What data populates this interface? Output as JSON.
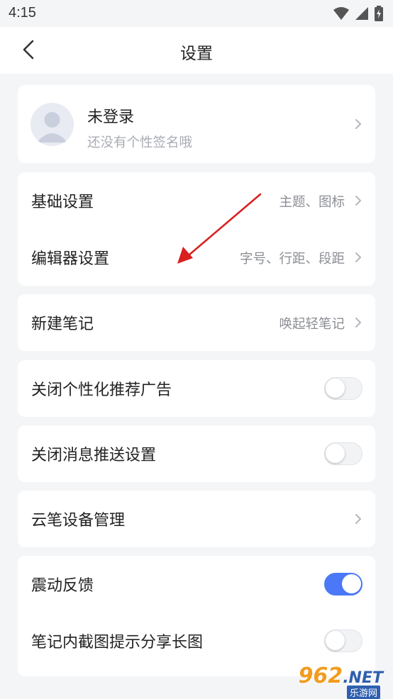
{
  "status_bar": {
    "time": "4:15",
    "icons": [
      "wifi-icon",
      "signal-icon",
      "battery-icon"
    ]
  },
  "header": {
    "title": "设置",
    "back_icon": "chevron-left-icon"
  },
  "user_card": {
    "name": "未登录",
    "signature": "还没有个性签名哦"
  },
  "settings": {
    "basic": {
      "label": "基础设置",
      "value": "主题、图标"
    },
    "editor": {
      "label": "编辑器设置",
      "value": "字号、行距、段距"
    },
    "new_note": {
      "label": "新建笔记",
      "value": "唤起轻笔记"
    },
    "close_ads": {
      "label": "关闭个性化推荐广告",
      "enabled": false
    },
    "close_push": {
      "label": "关闭消息推送设置",
      "enabled": false
    },
    "pen_device": {
      "label": "云笔设备管理"
    },
    "vibration": {
      "label": "震动反馈",
      "enabled": true
    },
    "screenshot_share": {
      "label": "笔记内截图提示分享长图",
      "enabled": false
    }
  },
  "annotation": {
    "arrow_color": "#d9201f"
  },
  "watermark": {
    "brand": "962",
    "suffix": ".NET",
    "sub": "乐游网"
  },
  "colors": {
    "accent": "#4a78f6",
    "background": "#f4f5f7",
    "secondary_text": "#8d8f95"
  }
}
